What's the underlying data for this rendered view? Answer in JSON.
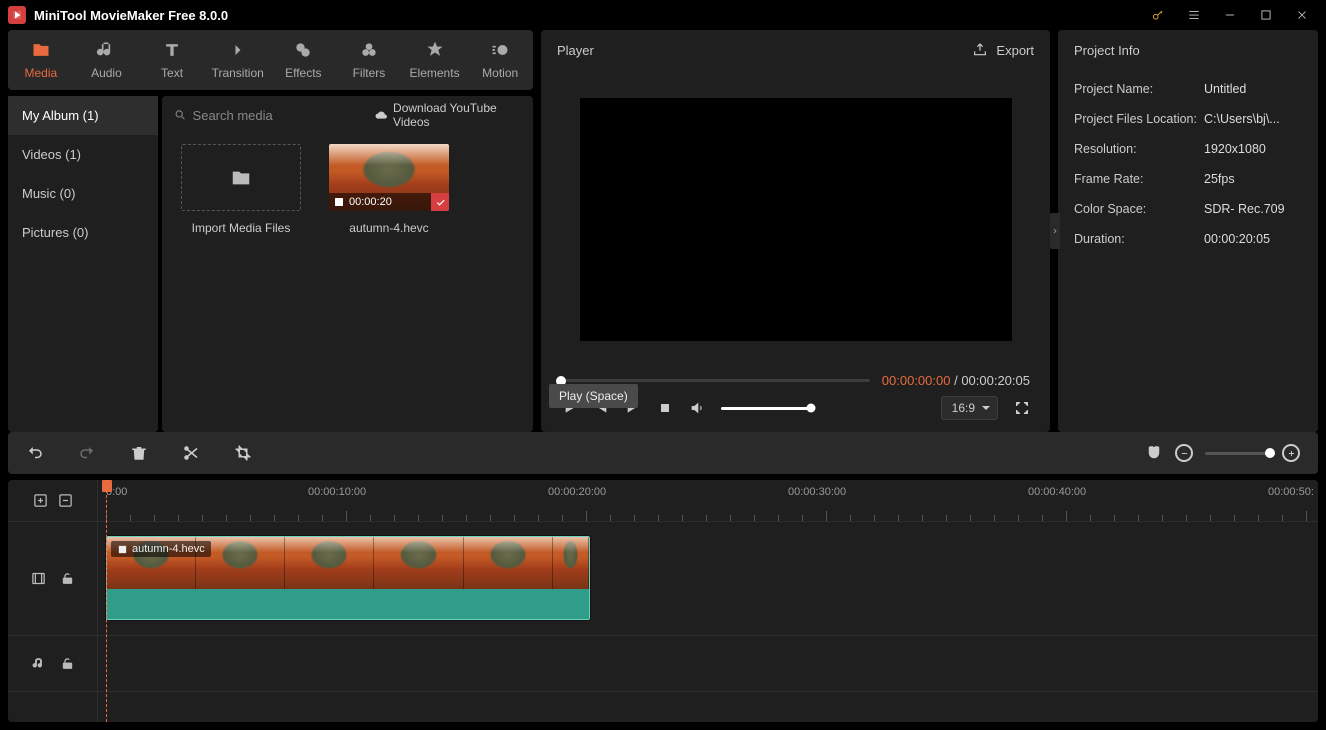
{
  "app": {
    "title": "MiniTool MovieMaker Free 8.0.0"
  },
  "tabs": {
    "media": "Media",
    "audio": "Audio",
    "text": "Text",
    "transition": "Transition",
    "effects": "Effects",
    "filters": "Filters",
    "elements": "Elements",
    "motion": "Motion"
  },
  "albums": {
    "myalbum": "My Album (1)",
    "videos": "Videos (1)",
    "music": "Music (0)",
    "pictures": "Pictures (0)"
  },
  "media": {
    "search_placeholder": "Search media",
    "yt_link": "Download YouTube Videos",
    "import_label": "Import Media Files",
    "clip_name": "autumn-4.hevc",
    "clip_dur": "00:00:20"
  },
  "player": {
    "title": "Player",
    "export": "Export",
    "tc_current": "00:00:00:00",
    "tc_sep": " / ",
    "tc_duration": "00:00:20:05",
    "aspect": "16:9",
    "play_tooltip": "Play (Space)"
  },
  "info": {
    "title": "Project Info",
    "rows": {
      "name_k": "Project Name:",
      "name_v": "Untitled",
      "loc_k": "Project Files Location:",
      "loc_v": "C:\\Users\\bj\\...",
      "res_k": "Resolution:",
      "res_v": "1920x1080",
      "fps_k": "Frame Rate:",
      "fps_v": "25fps",
      "cs_k": "Color Space:",
      "cs_v": "SDR- Rec.709",
      "dur_k": "Duration:",
      "dur_v": "00:00:20:05"
    }
  },
  "timeline": {
    "labels": {
      "t0": "0:00",
      "t10": "00:00:10:00",
      "t20": "00:00:20:00",
      "t30": "00:00:30:00",
      "t40": "00:00:40:00",
      "t50": "00:00:50:"
    },
    "clip_label": "autumn-4.hevc"
  }
}
